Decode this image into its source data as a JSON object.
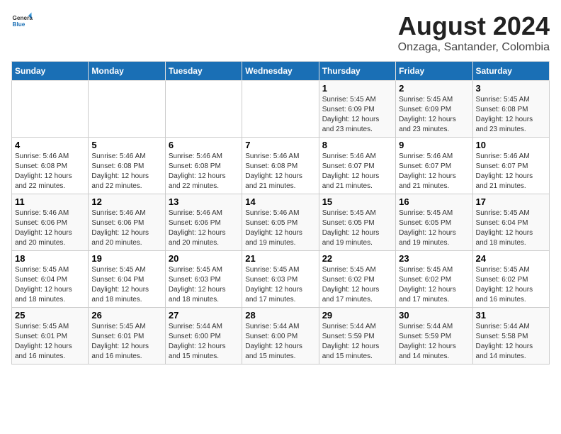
{
  "header": {
    "logo_general": "General",
    "logo_blue": "Blue",
    "main_title": "August 2024",
    "sub_title": "Onzaga, Santander, Colombia"
  },
  "calendar": {
    "days_of_week": [
      "Sunday",
      "Monday",
      "Tuesday",
      "Wednesday",
      "Thursday",
      "Friday",
      "Saturday"
    ],
    "weeks": [
      [
        {
          "day": "",
          "info": ""
        },
        {
          "day": "",
          "info": ""
        },
        {
          "day": "",
          "info": ""
        },
        {
          "day": "",
          "info": ""
        },
        {
          "day": "1",
          "info": "Sunrise: 5:45 AM\nSunset: 6:09 PM\nDaylight: 12 hours and 23 minutes."
        },
        {
          "day": "2",
          "info": "Sunrise: 5:45 AM\nSunset: 6:09 PM\nDaylight: 12 hours and 23 minutes."
        },
        {
          "day": "3",
          "info": "Sunrise: 5:45 AM\nSunset: 6:08 PM\nDaylight: 12 hours and 23 minutes."
        }
      ],
      [
        {
          "day": "4",
          "info": "Sunrise: 5:46 AM\nSunset: 6:08 PM\nDaylight: 12 hours and 22 minutes."
        },
        {
          "day": "5",
          "info": "Sunrise: 5:46 AM\nSunset: 6:08 PM\nDaylight: 12 hours and 22 minutes."
        },
        {
          "day": "6",
          "info": "Sunrise: 5:46 AM\nSunset: 6:08 PM\nDaylight: 12 hours and 22 minutes."
        },
        {
          "day": "7",
          "info": "Sunrise: 5:46 AM\nSunset: 6:08 PM\nDaylight: 12 hours and 21 minutes."
        },
        {
          "day": "8",
          "info": "Sunrise: 5:46 AM\nSunset: 6:07 PM\nDaylight: 12 hours and 21 minutes."
        },
        {
          "day": "9",
          "info": "Sunrise: 5:46 AM\nSunset: 6:07 PM\nDaylight: 12 hours and 21 minutes."
        },
        {
          "day": "10",
          "info": "Sunrise: 5:46 AM\nSunset: 6:07 PM\nDaylight: 12 hours and 21 minutes."
        }
      ],
      [
        {
          "day": "11",
          "info": "Sunrise: 5:46 AM\nSunset: 6:06 PM\nDaylight: 12 hours and 20 minutes."
        },
        {
          "day": "12",
          "info": "Sunrise: 5:46 AM\nSunset: 6:06 PM\nDaylight: 12 hours and 20 minutes."
        },
        {
          "day": "13",
          "info": "Sunrise: 5:46 AM\nSunset: 6:06 PM\nDaylight: 12 hours and 20 minutes."
        },
        {
          "day": "14",
          "info": "Sunrise: 5:46 AM\nSunset: 6:05 PM\nDaylight: 12 hours and 19 minutes."
        },
        {
          "day": "15",
          "info": "Sunrise: 5:45 AM\nSunset: 6:05 PM\nDaylight: 12 hours and 19 minutes."
        },
        {
          "day": "16",
          "info": "Sunrise: 5:45 AM\nSunset: 6:05 PM\nDaylight: 12 hours and 19 minutes."
        },
        {
          "day": "17",
          "info": "Sunrise: 5:45 AM\nSunset: 6:04 PM\nDaylight: 12 hours and 18 minutes."
        }
      ],
      [
        {
          "day": "18",
          "info": "Sunrise: 5:45 AM\nSunset: 6:04 PM\nDaylight: 12 hours and 18 minutes."
        },
        {
          "day": "19",
          "info": "Sunrise: 5:45 AM\nSunset: 6:04 PM\nDaylight: 12 hours and 18 minutes."
        },
        {
          "day": "20",
          "info": "Sunrise: 5:45 AM\nSunset: 6:03 PM\nDaylight: 12 hours and 18 minutes."
        },
        {
          "day": "21",
          "info": "Sunrise: 5:45 AM\nSunset: 6:03 PM\nDaylight: 12 hours and 17 minutes."
        },
        {
          "day": "22",
          "info": "Sunrise: 5:45 AM\nSunset: 6:02 PM\nDaylight: 12 hours and 17 minutes."
        },
        {
          "day": "23",
          "info": "Sunrise: 5:45 AM\nSunset: 6:02 PM\nDaylight: 12 hours and 17 minutes."
        },
        {
          "day": "24",
          "info": "Sunrise: 5:45 AM\nSunset: 6:02 PM\nDaylight: 12 hours and 16 minutes."
        }
      ],
      [
        {
          "day": "25",
          "info": "Sunrise: 5:45 AM\nSunset: 6:01 PM\nDaylight: 12 hours and 16 minutes."
        },
        {
          "day": "26",
          "info": "Sunrise: 5:45 AM\nSunset: 6:01 PM\nDaylight: 12 hours and 16 minutes."
        },
        {
          "day": "27",
          "info": "Sunrise: 5:44 AM\nSunset: 6:00 PM\nDaylight: 12 hours and 15 minutes."
        },
        {
          "day": "28",
          "info": "Sunrise: 5:44 AM\nSunset: 6:00 PM\nDaylight: 12 hours and 15 minutes."
        },
        {
          "day": "29",
          "info": "Sunrise: 5:44 AM\nSunset: 5:59 PM\nDaylight: 12 hours and 15 minutes."
        },
        {
          "day": "30",
          "info": "Sunrise: 5:44 AM\nSunset: 5:59 PM\nDaylight: 12 hours and 14 minutes."
        },
        {
          "day": "31",
          "info": "Sunrise: 5:44 AM\nSunset: 5:58 PM\nDaylight: 12 hours and 14 minutes."
        }
      ]
    ]
  }
}
